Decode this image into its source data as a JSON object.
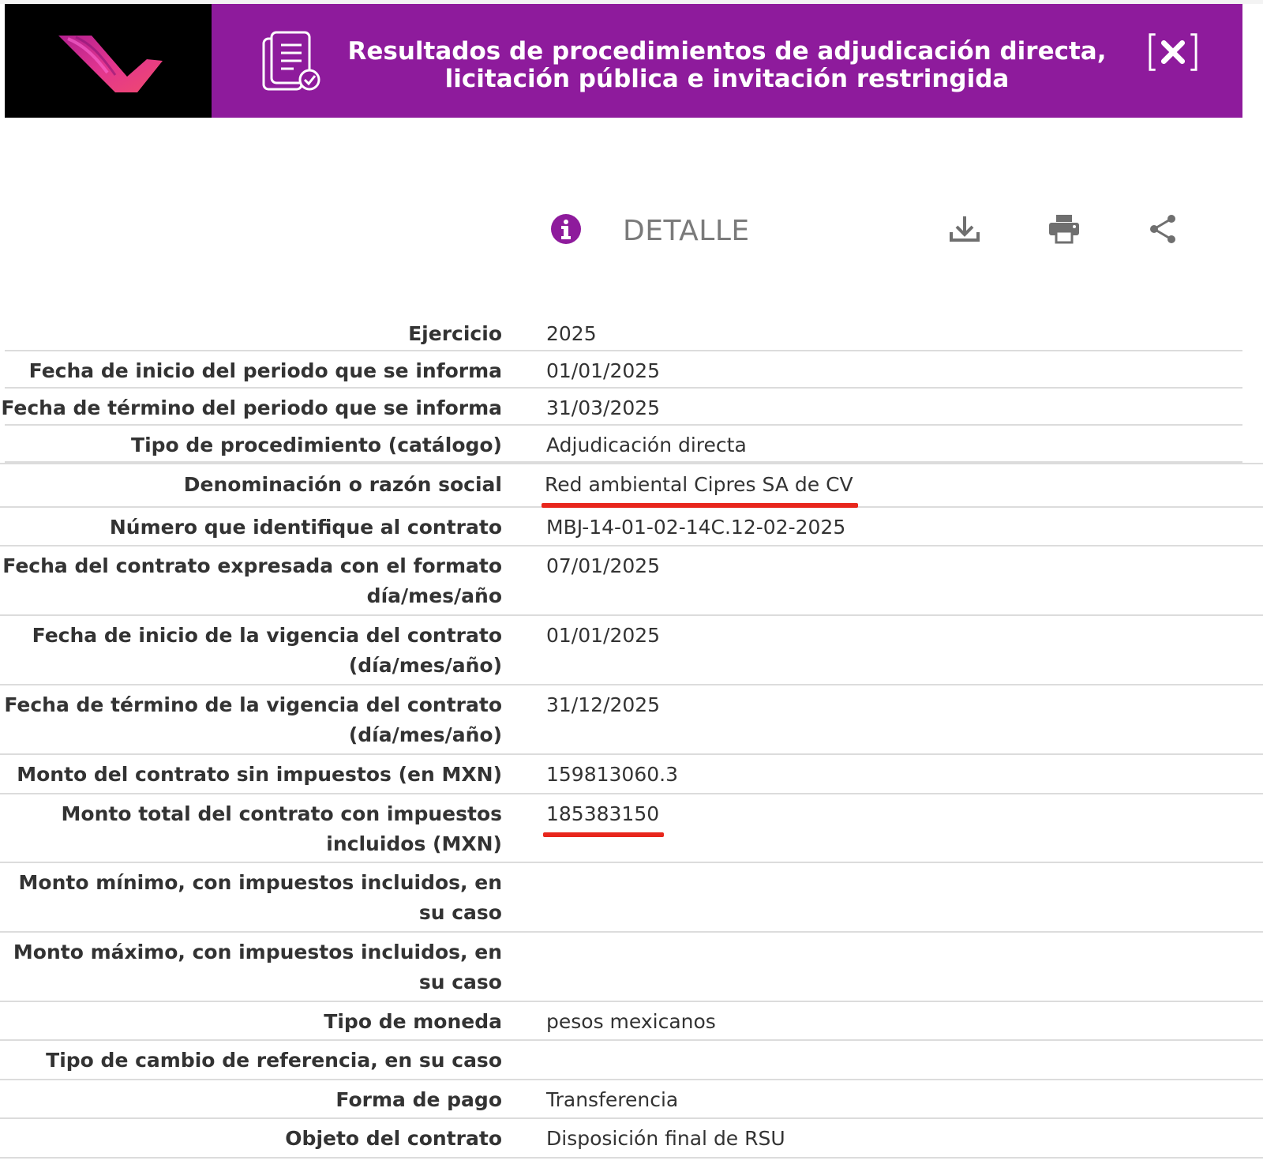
{
  "colors": {
    "header_bg": "#8e1b9c",
    "logo_bg": "#000000",
    "accent_purple": "#8e1b9c",
    "highlight_red": "#e8261c"
  },
  "header": {
    "title_line1": "Resultados de procedimientos de adjudicación directa,",
    "title_line2": "licitación pública e invitación restringida",
    "logo_icon": "brand-logo-icon",
    "doc_icon": "document-check-icon",
    "close_icon": "close-icon"
  },
  "toolbar": {
    "info_icon": "info-icon",
    "title": "DETALLE",
    "download_icon": "download-icon",
    "print_icon": "print-icon",
    "share_icon": "share-icon"
  },
  "rows": [
    {
      "label": "Ejercicio",
      "value": "2025"
    },
    {
      "label": "Fecha de inicio del periodo que se informa",
      "value": "01/01/2025"
    },
    {
      "label": "Fecha de término del periodo que se informa",
      "value": "31/03/2025"
    },
    {
      "label": "Tipo de procedimiento (catálogo)",
      "value": "Adjudicación directa"
    },
    {
      "label": "Denominación o razón social",
      "value": "Red ambiental Cipres SA de CV"
    },
    {
      "label": "Número que identifique al contrato",
      "value": "MBJ-14-01-02-14C.12-02-2025"
    },
    {
      "label_line1": "Fecha del contrato expresada con el formato",
      "label_line2": "día/mes/año",
      "value": "07/01/2025"
    },
    {
      "label_line1": "Fecha de inicio de la vigencia del contrato",
      "label_line2": "(día/mes/año)",
      "value": "01/01/2025"
    },
    {
      "label_line1": "Fecha de término de la vigencia del contrato",
      "label_line2": "(día/mes/año)",
      "value": "31/12/2025"
    },
    {
      "label": "Monto del contrato sin impuestos (en MXN)",
      "value": "159813060.3"
    },
    {
      "label_line1": "Monto total del contrato con impuestos",
      "label_line2": "incluidos (MXN)",
      "value": "185383150"
    },
    {
      "label_line1": "Monto mínimo, con impuestos incluidos, en",
      "label_line2": "su caso",
      "value": ""
    },
    {
      "label_line1": "Monto máximo, con impuestos incluidos, en",
      "label_line2": "su caso",
      "value": ""
    },
    {
      "label": "Tipo de moneda",
      "value": "pesos mexicanos"
    },
    {
      "label": "Tipo de cambio de referencia, en su caso",
      "value": ""
    },
    {
      "label": "Forma de pago",
      "value": "Transferencia"
    },
    {
      "label": "Objeto del contrato",
      "value": "Disposición final de RSU"
    }
  ]
}
